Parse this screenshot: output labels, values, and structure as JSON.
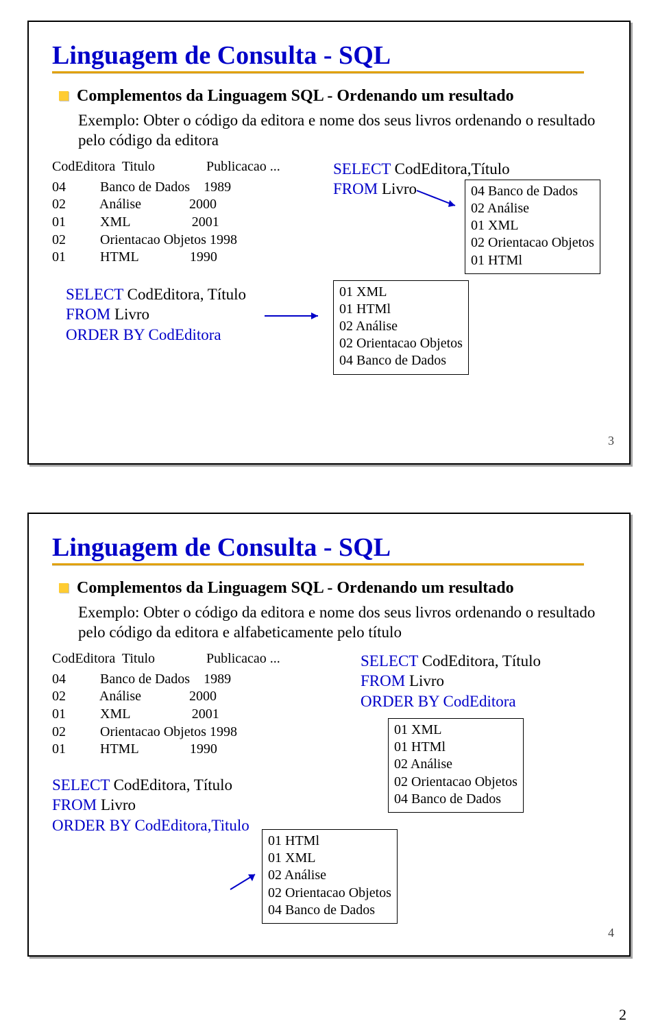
{
  "pageNumberOuter": "2",
  "slide3": {
    "title": "Linguagem de Consulta - SQL",
    "bullet": "Complementos da Linguagem SQL - Ordenando um resultado",
    "example": "Exemplo: Obter o código da editora e nome dos seus livros ordenando o resultado pelo código da editora",
    "tableHeader": "CodEditora  Titulo               Publicacao ...",
    "tableRows": "04          Banco de Dados    1989\n02          Análise              2000\n01          XML                  2001\n02          Orientacao Objetos 1998\n01          HTML               1990",
    "q1_l1a": "SELECT ",
    "q1_l1b": "CodEditora,Título",
    "q1_l2a": "FROM ",
    "q1_l2b": "Livro",
    "box1": "04 Banco de Dados\n02 Análise\n01 XML\n02 Orientacao Objetos\n01 HTMl",
    "q2_l1a": "SELECT ",
    "q2_l1b": "CodEditora, Título",
    "q2_l2a": "FROM ",
    "q2_l2b": "Livro",
    "q2_l3": "ORDER BY CodEditora",
    "box2": "01 XML\n01 HTMl\n02 Análise\n02 Orientacao Objetos\n04 Banco de Dados",
    "slideNum": "3"
  },
  "slide4": {
    "title": "Linguagem de Consulta - SQL",
    "bullet": "Complementos da Linguagem SQL - Ordenando um resultado",
    "example": "Exemplo: Obter o código da editora e nome dos seus livros ordenando o resultado pelo código da editora e alfabeticamente pelo título",
    "tableHeader": "CodEditora  Titulo               Publicacao ...",
    "tableRows": "04          Banco de Dados    1989\n02          Análise              2000\n01          XML                  2001\n02          Orientacao Objetos 1998\n01          HTML               1990",
    "q1_l1a": "SELECT ",
    "q1_l1b": "CodEditora, Título",
    "q1_l2a": "FROM ",
    "q1_l2b": "Livro",
    "q1_l3": "ORDER BY CodEditora,Titulo",
    "box1": "01 HTMl\n01 XML\n02 Análise\n02 Orientacao Objetos\n04 Banco de Dados",
    "q2_l1a": "SELECT ",
    "q2_l1b": "CodEditora, Título",
    "q2_l2a": "FROM ",
    "q2_l2b": "Livro",
    "q2_l3": "ORDER BY CodEditora",
    "box2": "01 XML\n01 HTMl\n02 Análise\n02 Orientacao Objetos\n04 Banco de Dados",
    "slideNum": "4"
  }
}
